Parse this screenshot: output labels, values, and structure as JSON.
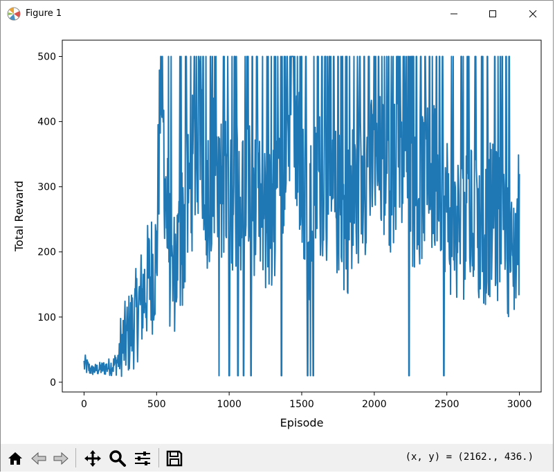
{
  "window": {
    "title": "Figure 1",
    "controls": [
      "minimize",
      "maximize",
      "close"
    ]
  },
  "toolbar": {
    "buttons": [
      {
        "name": "home",
        "icon": "home-icon"
      },
      {
        "name": "back",
        "icon": "arrow-left-icon"
      },
      {
        "name": "forward",
        "icon": "arrow-right-icon"
      },
      {
        "name": "pan",
        "icon": "move-icon"
      },
      {
        "name": "zoom",
        "icon": "magnifier-icon"
      },
      {
        "name": "configure-subplots",
        "icon": "sliders-icon"
      },
      {
        "name": "save",
        "icon": "floppy-disk-icon"
      }
    ],
    "coords_text": "(x, y) = (2162., 436.)"
  },
  "chart_data": {
    "type": "line",
    "title": "",
    "xlabel": "Episode",
    "ylabel": "Total Reward",
    "xlim": [
      -150,
      3150
    ],
    "ylim": [
      -15,
      525
    ],
    "xticks": [
      0,
      500,
      1000,
      1500,
      2000,
      2500,
      3000
    ],
    "yticks": [
      0,
      100,
      200,
      300,
      400,
      500
    ],
    "grid": false,
    "line_color": "#1f77b4",
    "series": [
      {
        "name": "",
        "description_points": [
          [
            0,
            30
          ],
          [
            50,
            12
          ],
          [
            100,
            15
          ],
          [
            150,
            20
          ],
          [
            200,
            25
          ],
          [
            250,
            50
          ],
          [
            300,
            70
          ],
          [
            350,
            95
          ],
          [
            400,
            130
          ],
          [
            450,
            160
          ],
          [
            500,
            190
          ],
          [
            530,
            500
          ],
          [
            560,
            300
          ],
          [
            600,
            150
          ],
          [
            650,
            200
          ],
          [
            700,
            250
          ],
          [
            750,
            330
          ],
          [
            800,
            380
          ],
          [
            850,
            290
          ],
          [
            900,
            330
          ],
          [
            950,
            280
          ],
          [
            1000,
            300
          ],
          [
            1050,
            280
          ],
          [
            1100,
            290
          ],
          [
            1150,
            300
          ],
          [
            1200,
            260
          ],
          [
            1250,
            250
          ],
          [
            1300,
            240
          ],
          [
            1350,
            280
          ],
          [
            1400,
            380
          ],
          [
            1450,
            410
          ],
          [
            1500,
            320
          ],
          [
            1550,
            230
          ],
          [
            1600,
            300
          ],
          [
            1650,
            310
          ],
          [
            1700,
            260
          ],
          [
            1750,
            280
          ],
          [
            1800,
            240
          ],
          [
            1850,
            280
          ],
          [
            1900,
            300
          ],
          [
            1950,
            320
          ],
          [
            2000,
            320
          ],
          [
            2050,
            330
          ],
          [
            2100,
            310
          ],
          [
            2150,
            330
          ],
          [
            2200,
            320
          ],
          [
            2250,
            300
          ],
          [
            2300,
            280
          ],
          [
            2350,
            320
          ],
          [
            2400,
            300
          ],
          [
            2450,
            330
          ],
          [
            2500,
            270
          ],
          [
            2550,
            230
          ],
          [
            2600,
            240
          ],
          [
            2650,
            250
          ],
          [
            2700,
            240
          ],
          [
            2750,
            230
          ],
          [
            2800,
            250
          ],
          [
            2850,
            240
          ],
          [
            2900,
            250
          ],
          [
            2950,
            180
          ],
          [
            3000,
            250
          ]
        ],
        "spikes_to_500": [
          530,
          540,
          600,
          660,
          700,
          760,
          790,
          820,
          840,
          870,
          900,
          930,
          960,
          990,
          1020,
          1050,
          1110,
          1130,
          1160,
          1190,
          1230,
          1260,
          1290,
          1320,
          1360,
          1380,
          1400,
          1420,
          1440,
          1470,
          1500,
          1530,
          1560,
          1580,
          1610,
          1640,
          1660,
          1690,
          1720,
          1750,
          1780,
          1810,
          1830,
          1860,
          1900,
          1930,
          1960,
          2000,
          2030,
          2070,
          2100,
          2130,
          2160,
          2200,
          2220,
          2260,
          2290,
          2320,
          2350,
          2380,
          2400,
          2430,
          2450,
          2470,
          2600,
          2640,
          2700,
          2740,
          2780,
          2830,
          2880,
          2910
        ],
        "drops_to_low": [
          930,
          1000,
          1060,
          1100,
          1150,
          1360,
          1540,
          1560,
          1580,
          2240,
          2480
        ]
      }
    ]
  }
}
